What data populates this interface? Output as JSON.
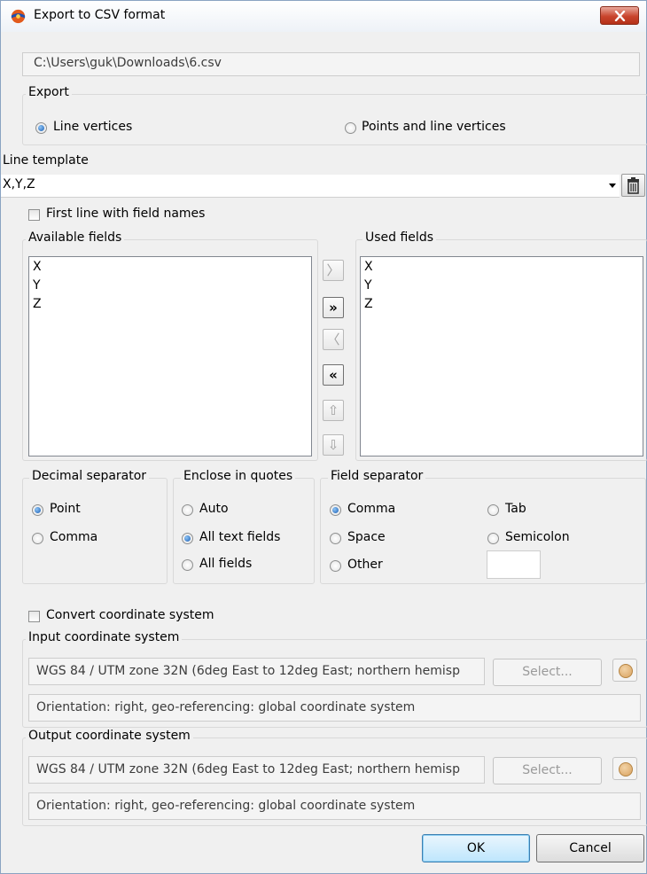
{
  "window": {
    "title": "Export to CSV format"
  },
  "file_path": "C:\\Users\\guk\\Downloads\\6.csv",
  "export": {
    "label": "Export",
    "options": [
      {
        "label": "Line vertices",
        "selected": true
      },
      {
        "label": "Points and line vertices",
        "selected": false
      }
    ]
  },
  "line_template": {
    "label": "Line template",
    "value": "X,Y,Z"
  },
  "first_line": {
    "label": "First line with field names",
    "checked": false
  },
  "available_fields": {
    "label": "Available fields",
    "items": [
      "X",
      "Y",
      "Z"
    ]
  },
  "used_fields": {
    "label": "Used fields",
    "items": [
      "X",
      "Y",
      "Z"
    ]
  },
  "transfer_buttons": [
    {
      "glyph": "〉",
      "enabled": false
    },
    {
      "glyph": "»",
      "enabled": true
    },
    {
      "glyph": "〈",
      "enabled": false
    },
    {
      "glyph": "«",
      "enabled": true
    },
    {
      "glyph": "⇧",
      "enabled": false
    },
    {
      "glyph": "⇩",
      "enabled": false
    }
  ],
  "decimal_separator": {
    "label": "Decimal separator",
    "options": [
      {
        "label": "Point",
        "selected": true
      },
      {
        "label": "Comma",
        "selected": false
      }
    ]
  },
  "enclose_in_quotes": {
    "label": "Enclose in quotes",
    "options": [
      {
        "label": "Auto",
        "selected": false
      },
      {
        "label": "All text fields",
        "selected": true
      },
      {
        "label": "All fields",
        "selected": false
      }
    ]
  },
  "field_separator": {
    "label": "Field separator",
    "options": [
      {
        "label": "Comma",
        "selected": true
      },
      {
        "label": "Tab",
        "selected": false
      },
      {
        "label": "Space",
        "selected": false
      },
      {
        "label": "Semicolon",
        "selected": false
      },
      {
        "label": "Other",
        "selected": false
      }
    ],
    "other_value": ""
  },
  "convert": {
    "label": "Convert coordinate system",
    "checked": false
  },
  "input_cs": {
    "label": "Input coordinate system",
    "value": "WGS 84 / UTM zone 32N (6deg East to 12deg East; northern hemisp",
    "select_label": "Select...",
    "orientation": "Orientation: right, geo-referencing: global coordinate system"
  },
  "output_cs": {
    "label": "Output coordinate system",
    "value": "WGS 84 / UTM zone 32N (6deg East to 12deg East; northern hemisp",
    "select_label": "Select...",
    "orientation": "Orientation: right, geo-referencing: global coordinate system"
  },
  "buttons": {
    "ok": "OK",
    "cancel": "Cancel"
  },
  "icons": {
    "app": "app-logo-icon",
    "close": "close-icon",
    "trash": "trash-icon",
    "dropdown": "chevron-down-icon",
    "globe": "globe-icon"
  }
}
